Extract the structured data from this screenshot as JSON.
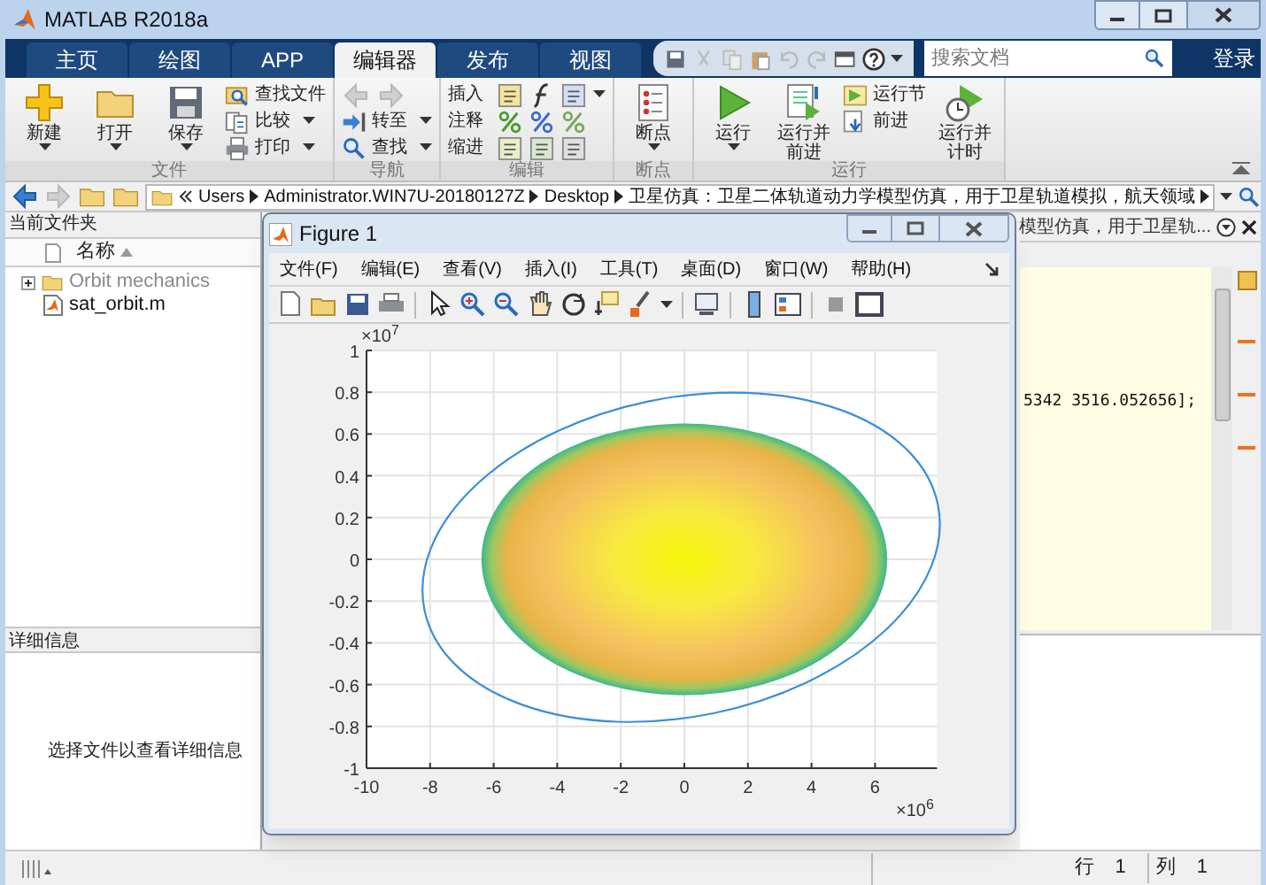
{
  "window": {
    "title": "MATLAB R2018a"
  },
  "ribbon_tabs": [
    {
      "label": "主页",
      "selected": false
    },
    {
      "label": "绘图",
      "selected": false
    },
    {
      "label": "APP",
      "selected": false
    },
    {
      "label": "编辑器",
      "selected": true
    },
    {
      "label": "发布",
      "selected": false
    },
    {
      "label": "视图",
      "selected": false
    }
  ],
  "search": {
    "placeholder": "搜索文档"
  },
  "sign_in": "登录",
  "ribbon_groups": [
    {
      "label": "文件",
      "items": [
        {
          "kind": "large",
          "label": "新建",
          "dropdown": true
        },
        {
          "kind": "large",
          "label": "打开",
          "dropdown": true
        },
        {
          "kind": "large",
          "label": "保存",
          "dropdown": true
        },
        {
          "kind": "small",
          "label": "查找文件",
          "dropdown": false
        },
        {
          "kind": "small",
          "label": "比较",
          "dropdown": true
        },
        {
          "kind": "small",
          "label": "打印",
          "dropdown": true
        }
      ]
    },
    {
      "label": "导航",
      "items": [
        {
          "kind": "arrows",
          "disabled": true
        },
        {
          "kind": "small",
          "label": "转至",
          "dropdown": true
        },
        {
          "kind": "small",
          "label": "查找",
          "dropdown": true
        }
      ]
    },
    {
      "label": "编辑",
      "items": [
        {
          "kind": "row",
          "label": "插入",
          "dropdown": true
        },
        {
          "kind": "row",
          "label": "注释",
          "dropdown": false
        },
        {
          "kind": "row",
          "label": "缩进",
          "dropdown": false
        }
      ]
    },
    {
      "label": "断点",
      "items": [
        {
          "kind": "large",
          "label": "断点",
          "dropdown": true
        }
      ]
    },
    {
      "label": "运行",
      "items": [
        {
          "kind": "large",
          "label": "运行",
          "dropdown": true
        },
        {
          "kind": "large",
          "label": "运行并前进",
          "dropdown": false
        },
        {
          "kind": "small",
          "label": "运行节",
          "dropdown": false
        },
        {
          "kind": "small",
          "label": "前进",
          "dropdown": false
        },
        {
          "kind": "large",
          "label": "运行并计时",
          "dropdown": false
        }
      ]
    }
  ],
  "address_path": [
    "Users",
    "Administrator.WIN7U-20180127Z",
    "Desktop",
    "卫星仿真：卫星二体轨道动力学模型仿真，用于卫星轨道模拟，航天领域"
  ],
  "current_folder": {
    "title": "当前文件夹",
    "column": "名称",
    "items": [
      {
        "kind": "folder",
        "label": "Orbit mechanics",
        "expanded": false
      },
      {
        "kind": "file",
        "label": "sat_orbit.m"
      }
    ]
  },
  "details": {
    "title": "详细信息",
    "message": "选择文件以查看详细信息"
  },
  "editor": {
    "tab_title": "模型仿真，用于卫星轨...",
    "code_line": "5342 3516.052656];"
  },
  "figure": {
    "title": "Figure 1",
    "menu": [
      "文件(F)",
      "编辑(E)",
      "查看(V)",
      "插入(I)",
      "工具(T)",
      "桌面(D)",
      "窗口(W)",
      "帮助(H)"
    ],
    "y_exponent": "×10$^{7}$",
    "x_exponent": "×10$^{6}$",
    "chart_data": {
      "type": "line",
      "grid": true,
      "xlim": [
        -10,
        7.95
      ],
      "ylim": [
        -1,
        1
      ],
      "xticks": [
        -10,
        -8,
        -6,
        -4,
        -2,
        0,
        2,
        4,
        6
      ],
      "yticks": [
        -1,
        -0.8,
        -0.6,
        -0.4,
        -0.2,
        0,
        0.2,
        0.4,
        0.6,
        0.8,
        1
      ]
    }
  },
  "status_bar": {
    "line_label": "行",
    "line": "1",
    "col_label": "列",
    "col": "1"
  }
}
